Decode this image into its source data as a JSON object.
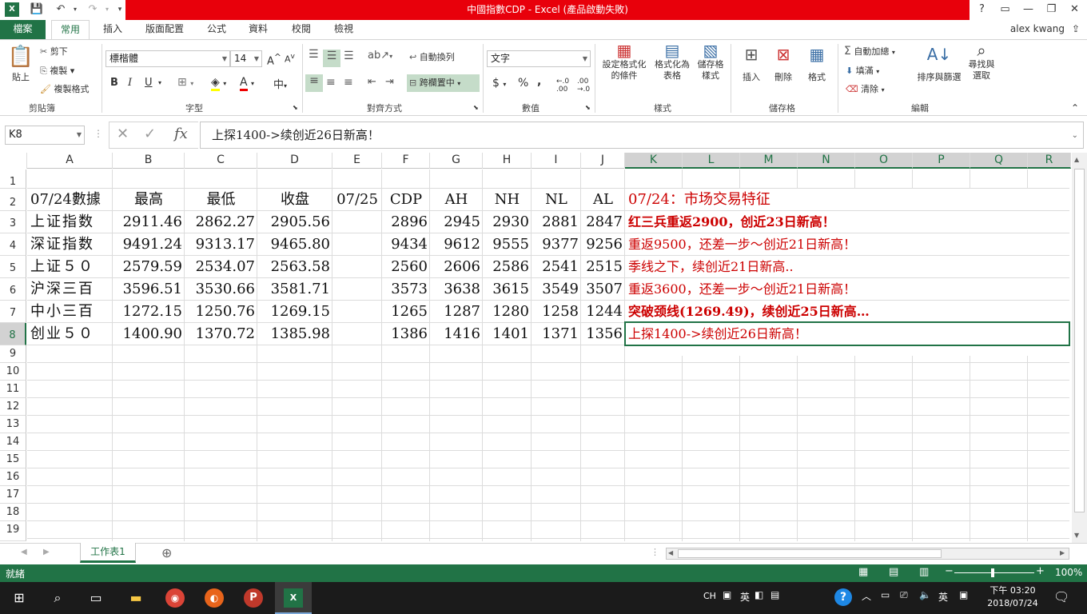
{
  "window": {
    "title": "中國指數CDP - Excel (產品啟動失敗)",
    "user": "alex kwang",
    "help": "?",
    "minimize": "—",
    "restore": "❐",
    "close": "✕"
  },
  "tabs": [
    "檔案",
    "常用",
    "插入",
    "版面配置",
    "公式",
    "資料",
    "校閱",
    "檢視"
  ],
  "ribbon": {
    "clipboard": {
      "paste": "貼上",
      "cut": "剪下",
      "copy": "複製",
      "format_painter": "複製格式",
      "label": "剪貼簿"
    },
    "font": {
      "name": "標楷體",
      "size": "14",
      "bold": "B",
      "italic": "I",
      "underline": "U",
      "label": "字型"
    },
    "alignment": {
      "wrap": "自動換列",
      "merge": "跨欄置中",
      "label": "對齊方式"
    },
    "number": {
      "format": "文字",
      "currency": "$",
      "percent": "%",
      "comma": ",",
      "label": "數值"
    },
    "styles": {
      "conditional": "設定格式化的條件",
      "as_table": "格式化為表格",
      "cell_styles": "儲存格樣式",
      "label": "樣式"
    },
    "cells": {
      "insert": "插入",
      "delete": "刪除",
      "format": "格式",
      "label": "儲存格"
    },
    "editing": {
      "autosum": "自動加總",
      "fill": "填滿",
      "clear": "清除",
      "sort": "排序與篩選",
      "find": "尋找與選取",
      "label": "編輯"
    }
  },
  "formula_bar": {
    "name_box": "K8",
    "fx": "fx",
    "content": "上探1400->续创近26日新高！"
  },
  "columns": [
    "A",
    "B",
    "C",
    "D",
    "E",
    "F",
    "G",
    "H",
    "I",
    "J",
    "K",
    "L",
    "M",
    "N",
    "O",
    "P",
    "Q",
    "R"
  ],
  "rows": [
    "1",
    "2",
    "3",
    "4",
    "5",
    "6",
    "7",
    "8",
    "9",
    "10",
    "11",
    "12",
    "13",
    "14",
    "15",
    "16",
    "17",
    "18",
    "19"
  ],
  "header_row": {
    "a": "07/24數據",
    "b": "最高",
    "c": "最低",
    "d": "收盘",
    "e": "07/25",
    "f": "CDP",
    "g": "AH",
    "h": "NH",
    "i": "NL",
    "j": "AL",
    "k": "07/24：市场交易特征"
  },
  "data_rows": [
    {
      "a": "上证指数",
      "b": "2911.46",
      "c": "2862.27",
      "d": "2905.56",
      "f": "2896",
      "g": "2945",
      "h": "2930",
      "i": "2881",
      "j": "2847",
      "k": "红三兵重返2900，创近23日新高！"
    },
    {
      "a": "深证指数",
      "b": "9491.24",
      "c": "9313.17",
      "d": "9465.80",
      "f": "9434",
      "g": "9612",
      "h": "9555",
      "i": "9377",
      "j": "9256",
      "k": "重返9500，还差一步～创近21日新高！"
    },
    {
      "a": "上证５０",
      "b": "2579.59",
      "c": "2534.07",
      "d": "2563.58",
      "f": "2560",
      "g": "2606",
      "h": "2586",
      "i": "2541",
      "j": "2515",
      "k": "季线之下，续创近21日新高.."
    },
    {
      "a": "沪深三百",
      "b": "3596.51",
      "c": "3530.66",
      "d": "3581.71",
      "f": "3573",
      "g": "3638",
      "h": "3615",
      "i": "3549",
      "j": "3507",
      "k": "重返3600，还差一步～创近21日新高！"
    },
    {
      "a": "中小三百",
      "b": "1272.15",
      "c": "1250.76",
      "d": "1269.15",
      "f": "1265",
      "g": "1287",
      "h": "1280",
      "i": "1258",
      "j": "1244",
      "k": "突破颈线(1269.49)，续创近25日新高…"
    },
    {
      "a": "创业５０",
      "b": "1400.90",
      "c": "1370.72",
      "d": "1385.98",
      "f": "1386",
      "g": "1416",
      "h": "1401",
      "i": "1371",
      "j": "1356",
      "k": "上探1400->续创近26日新高！"
    }
  ],
  "sheet": {
    "tab": "工作表1",
    "add": "⊕"
  },
  "status": {
    "ready": "就緒",
    "zoom": "100%"
  },
  "taskbar": {
    "ime1": "CH",
    "ime2": "英",
    "lang": "英",
    "time": "下午 03:20",
    "date": "2018/07/24"
  },
  "colors": {
    "excel_green": "#217346",
    "title_red": "#e8000b",
    "note_red": "#c00000"
  }
}
